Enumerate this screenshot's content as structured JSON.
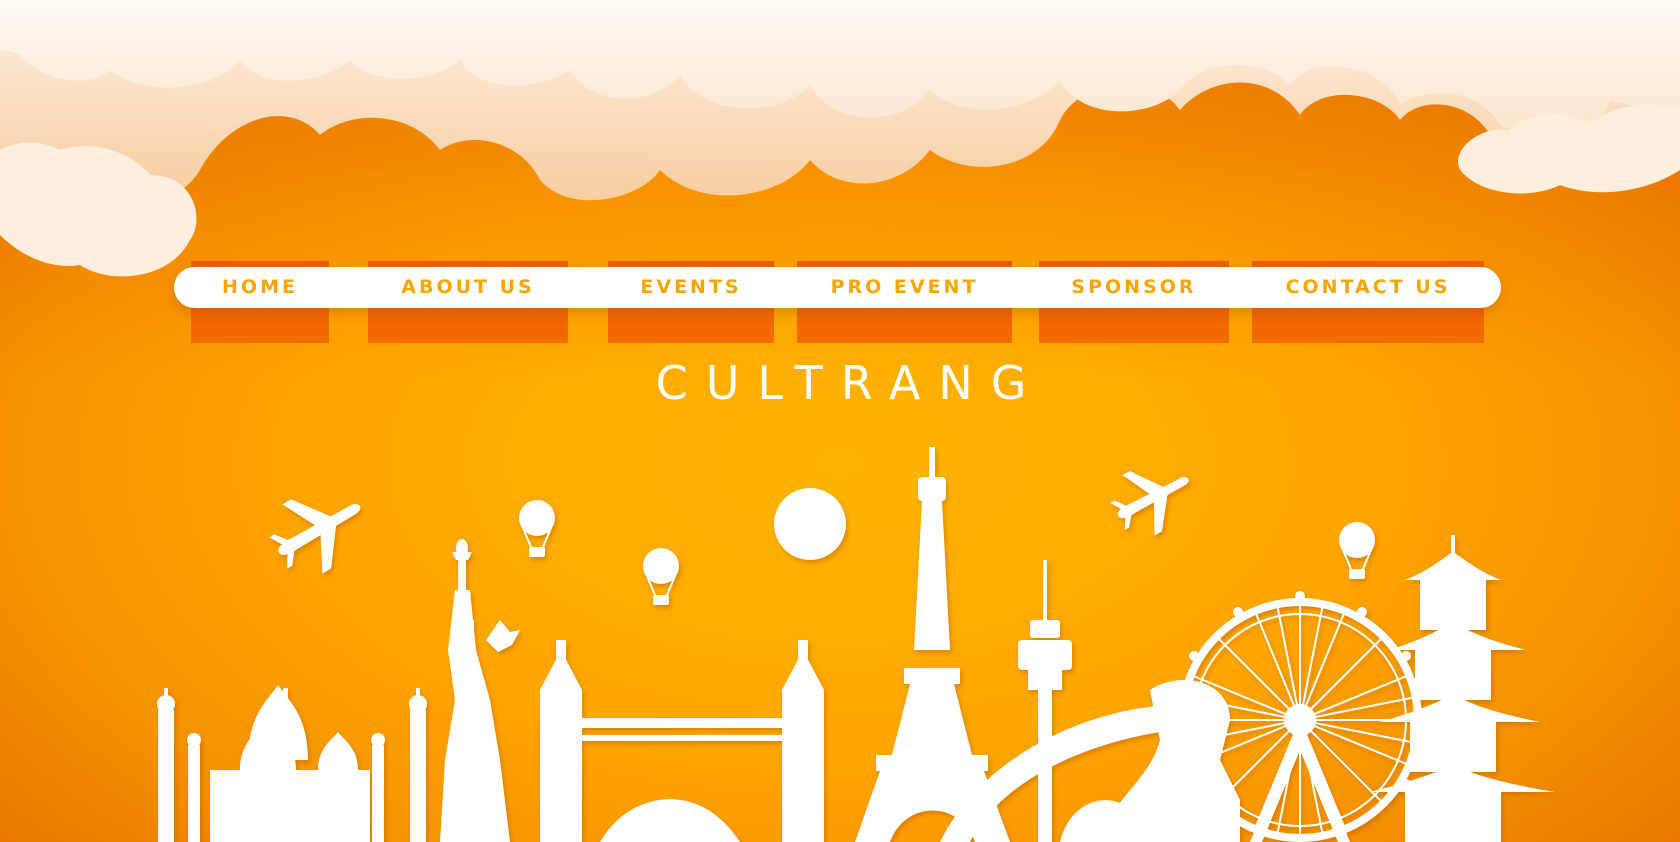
{
  "brand": {
    "name": "CULTRANG"
  },
  "nav": {
    "items": [
      {
        "label": "HOME"
      },
      {
        "label": "ABOUT US"
      },
      {
        "label": "EVENTS"
      },
      {
        "label": "PRO EVENT"
      },
      {
        "label": "SPONSOR"
      },
      {
        "label": "CONTACT US"
      }
    ]
  },
  "colors": {
    "background": "#ffa500",
    "nav_text": "#f7a500",
    "tab_accent": "#f05a00",
    "silhouettes": "#ffffff",
    "clouds": "#fbe9d6"
  },
  "decorations": [
    "cloud-icon",
    "airplane-icon",
    "hot-air-balloon-icon",
    "sun-icon",
    "taj-mahal-icon",
    "statue-of-liberty-icon",
    "tower-bridge-icon",
    "eiffel-tower-icon",
    "sydney-tower-icon",
    "merlion-icon",
    "ferris-wheel-icon",
    "pagoda-icon"
  ]
}
